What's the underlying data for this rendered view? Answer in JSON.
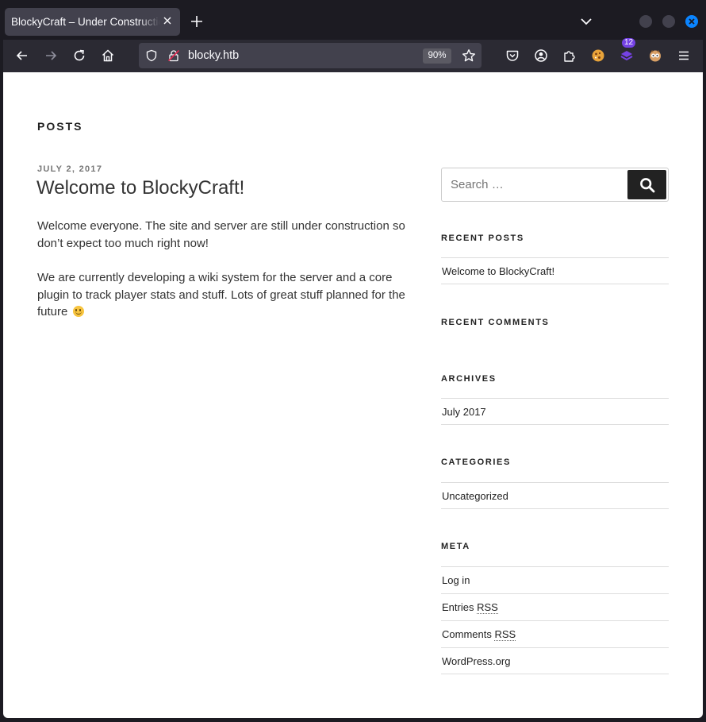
{
  "browser": {
    "tab_title": "BlockyCraft – Under Construction",
    "url": "blocky.htb",
    "zoom": "90%",
    "extension_badge": "12",
    "accent_color": "#0a84ff"
  },
  "page": {
    "heading": "POSTS",
    "post": {
      "date": "JULY 2, 2017",
      "title": "Welcome to BlockyCraft!",
      "paragraph1": "Welcome everyone. The site and server are still under construction so don’t expect too much right now!",
      "paragraph2": "We are currently developing a wiki system for the server and a core plugin to track player stats and stuff. Lots of great stuff planned for the future"
    },
    "search": {
      "placeholder": "Search …"
    },
    "sidebar": {
      "recent_posts_title": "RECENT POSTS",
      "recent_posts": [
        "Welcome to BlockyCraft!"
      ],
      "recent_comments_title": "RECENT COMMENTS",
      "archives_title": "ARCHIVES",
      "archives": [
        "July 2017"
      ],
      "categories_title": "CATEGORIES",
      "categories": [
        "Uncategorized"
      ],
      "meta_title": "META",
      "meta": {
        "login": "Log in",
        "entries_prefix": "Entries ",
        "entries_abbr": "RSS",
        "comments_prefix": "Comments ",
        "comments_abbr": "RSS",
        "wordpress": "WordPress.org"
      }
    }
  }
}
